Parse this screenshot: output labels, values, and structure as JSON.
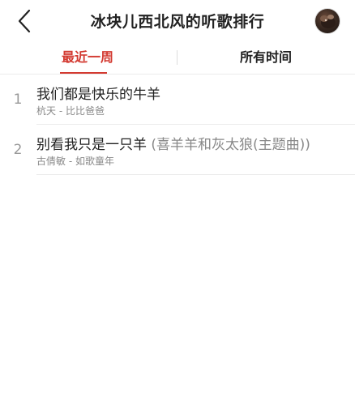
{
  "header": {
    "title": "冰块儿西北风的听歌排行",
    "back_icon": "chevron-left-icon",
    "avatar_icon": "user-avatar"
  },
  "tabs": [
    {
      "label": "最近一周",
      "active": true
    },
    {
      "label": "所有时间",
      "active": false
    }
  ],
  "colors": {
    "accent": "#d33a31",
    "text_primary": "#222222",
    "text_secondary": "#8a8a8a"
  },
  "songs": [
    {
      "rank": "1",
      "title": "我们都是快乐的牛羊",
      "alias": "",
      "artist": "杭天",
      "album": "比比爸爸"
    },
    {
      "rank": "2",
      "title": "别看我只是一只羊",
      "alias": "(喜羊羊和灰太狼(主题曲))",
      "artist": "古倩敏",
      "album": "如歌童年"
    }
  ]
}
